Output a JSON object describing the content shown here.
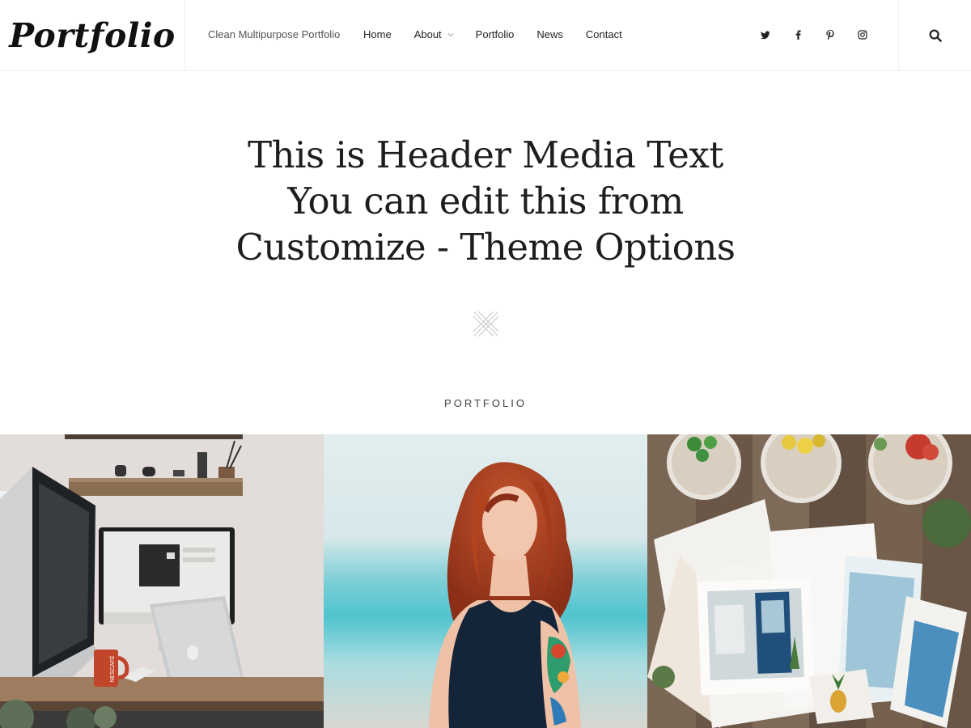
{
  "header": {
    "site_title": "Portfolio",
    "tagline": "Clean Multipurpose Portfolio",
    "nav": [
      {
        "label": "Home"
      },
      {
        "label": "About",
        "has_dropdown": true
      },
      {
        "label": "Portfolio"
      },
      {
        "label": "News"
      },
      {
        "label": "Contact"
      }
    ],
    "social_icons": [
      "twitter-icon",
      "facebook-icon",
      "pinterest-icon",
      "instagram-icon"
    ],
    "search_icon": "search-icon"
  },
  "hero": {
    "lines": [
      "This is Header Media Text",
      "You can edit this from",
      "Customize - Theme Options"
    ]
  },
  "section": {
    "label": "PORTFOLIO"
  },
  "gallery": {
    "items": [
      {
        "subject": "desk-workspace"
      },
      {
        "subject": "woman-beach"
      },
      {
        "subject": "photos-on-wood"
      }
    ],
    "mug_text": "NESCAFÉ"
  },
  "colors": {
    "text": "#222222",
    "border": "#eeeeee",
    "background": "#ffffff"
  }
}
